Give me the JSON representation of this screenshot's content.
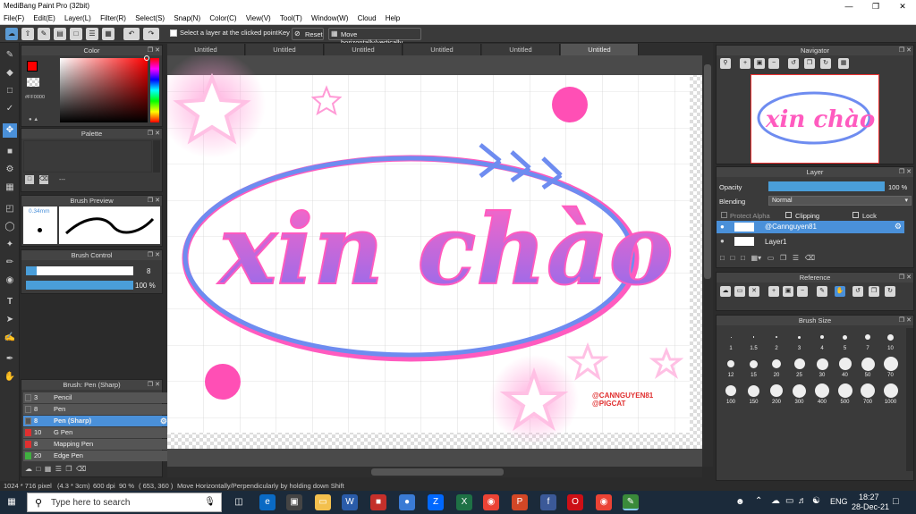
{
  "window": {
    "title": "MediBang Paint Pro (32bit)"
  },
  "menu": [
    "File(F)",
    "Edit(E)",
    "Layer(L)",
    "Filter(R)",
    "Select(S)",
    "Snap(N)",
    "Color(C)",
    "View(V)",
    "Tool(T)",
    "Window(W)",
    "Cloud",
    "Help"
  ],
  "toolbar": {
    "select_layer_label": "Select a layer at the clicked point",
    "key_label": "Key",
    "reset_label": "Reset",
    "move_label": "Move horizontally/vertically"
  },
  "color_panel": {
    "title": "Color",
    "hex": "#FF0000",
    "primary": "#ff0000"
  },
  "palette_panel": {
    "title": "Palette",
    "footer": "---"
  },
  "brush_preview": {
    "title": "Brush Preview",
    "size": "0.34mm"
  },
  "brush_control": {
    "title": "Brush Control",
    "size_value": "8",
    "opacity_value": "100 %",
    "size_fraction": 0.1,
    "opacity_fraction": 1.0
  },
  "brush_list": {
    "title": "Brush: Pen (Sharp)",
    "items": [
      {
        "n": "3",
        "label": "Pencil",
        "color": "#555555"
      },
      {
        "n": "8",
        "label": "Pen",
        "color": "#555555"
      },
      {
        "n": "8",
        "label": "Pen (Sharp)",
        "color": "#555555",
        "active": true
      },
      {
        "n": "10",
        "label": "G Pen",
        "color": "#e03030"
      },
      {
        "n": "8",
        "label": "Mapping Pen",
        "color": "#e03030"
      },
      {
        "n": "20",
        "label": "Edge Pen",
        "color": "#40b040"
      }
    ]
  },
  "tabs": [
    "Untitled",
    "Untitled",
    "Untitled",
    "Untitled",
    "Untitled",
    "Untitled"
  ],
  "canvas": {
    "text": "xin chào",
    "watermark": "@CANNGUYEN81\n@PIGCAT"
  },
  "navigator": {
    "title": "Navigator",
    "preview_text": "xin chào"
  },
  "layer_panel": {
    "title": "Layer",
    "opacity_label": "Opacity",
    "opacity_value": "100 %",
    "opacity_fraction": 1.0,
    "blending_label": "Blending",
    "blending_value": "Normal",
    "protect_alpha": "Protect Alpha",
    "clipping": "Clipping",
    "lock": "Lock",
    "layers": [
      "@Cannguyen81",
      "Layer1"
    ]
  },
  "reference_panel": {
    "title": "Reference"
  },
  "brush_size_panel": {
    "title": "Brush Size",
    "rows": [
      [
        "1",
        "1.5",
        "2",
        "3",
        "4",
        "5",
        "7",
        "10"
      ],
      [
        "12",
        "15",
        "20",
        "25",
        "30",
        "40",
        "50",
        "70"
      ],
      [
        "100",
        "150",
        "200",
        "300",
        "400",
        "500",
        "700",
        "1000"
      ]
    ]
  },
  "status": {
    "dimensions": "1024 * 716 pixel",
    "size_cm": "(4.3 * 3cm)",
    "dpi": "600 dpi",
    "zoom": "90 %",
    "coords": "( 653, 360 )",
    "hint": "Move Horizontally/Perpendicularly by holding down Shift"
  },
  "taskbar": {
    "search_placeholder": "Type here to search",
    "lang": "ENG",
    "time": "18:27",
    "date": "28-Dec-21"
  }
}
